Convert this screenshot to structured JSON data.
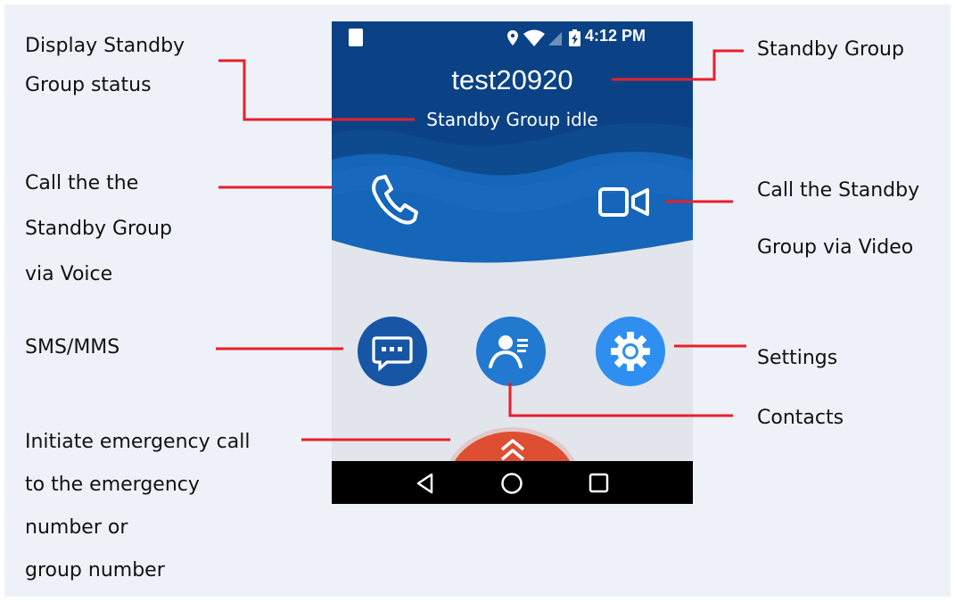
{
  "phone": {
    "status_bar": {
      "time": "4:12 PM"
    },
    "group_name": "test20920",
    "group_status": "Standby Group idle"
  },
  "callouts": {
    "display_status": [
      "Display Standby",
      "Group status"
    ],
    "call_voice": [
      "Call the the",
      "Standby Group",
      "via Voice"
    ],
    "sms": "SMS/MMS",
    "emergency": [
      "Initiate emergency call",
      "to the emergency",
      "number or",
      "group number"
    ],
    "standby_group": "Standby Group",
    "call_video": [
      "Call the Standby",
      "Group via Video"
    ],
    "settings": "Settings",
    "contacts": "Contacts"
  },
  "colors": {
    "leader_line": "#e8202a",
    "header_blue": "#0e4f96",
    "wave_blue": "#1565b8",
    "sms_button": "#1656a4",
    "contacts_button": "#2279d0",
    "settings_button": "#2f8ff0",
    "emergency_button": "#de4e30",
    "nav_bar": "#000000",
    "background": "#eef2f8"
  }
}
